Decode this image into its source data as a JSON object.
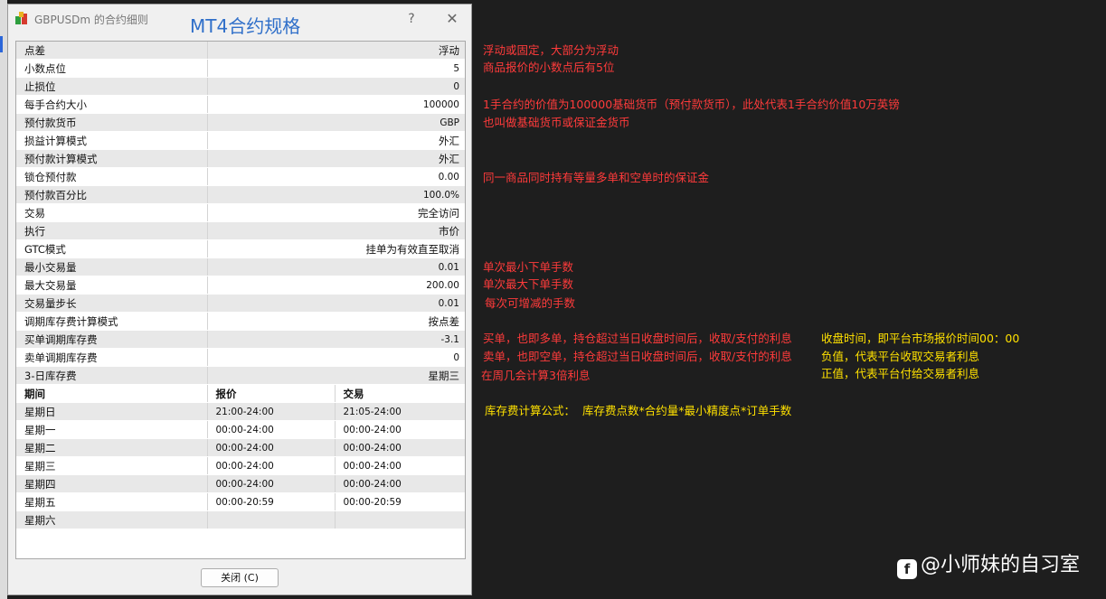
{
  "window": {
    "title": "GBPUSDm 的合约细则",
    "overlay_title": "MT4合约规格",
    "help_glyph": "?",
    "close_glyph": "✕",
    "close_button": "关闭 (C)"
  },
  "specs": [
    {
      "label": "点差",
      "value": "浮动"
    },
    {
      "label": "小数点位",
      "value": "5"
    },
    {
      "label": "止损位",
      "value": "0"
    },
    {
      "label": "每手合约大小",
      "value": "100000"
    },
    {
      "label": "预付款货币",
      "value": "GBP"
    },
    {
      "label": "损益计算模式",
      "value": "外汇"
    },
    {
      "label": "预付款计算模式",
      "value": "外汇"
    },
    {
      "label": "锁仓预付款",
      "value": "0.00"
    },
    {
      "label": "预付款百分比",
      "value": "100.0%"
    },
    {
      "label": "交易",
      "value": "完全访问"
    },
    {
      "label": "执行",
      "value": "市价"
    },
    {
      "label": "GTC模式",
      "value": "挂单为有效直至取消"
    },
    {
      "label": "最小交易量",
      "value": "0.01"
    },
    {
      "label": "最大交易量",
      "value": "200.00"
    },
    {
      "label": "交易量步长",
      "value": "0.01"
    },
    {
      "label": "调期库存费计算模式",
      "value": "按点差"
    },
    {
      "label": "买单调期库存费",
      "value": "-3.1"
    },
    {
      "label": "卖单调期库存费",
      "value": "0"
    },
    {
      "label": "3-日库存费",
      "value": "星期三"
    }
  ],
  "schedule": {
    "headers": [
      "期间",
      "报价",
      "交易"
    ],
    "rows": [
      {
        "day": "星期日",
        "quote": "21:00-24:00",
        "trade": "21:05-24:00"
      },
      {
        "day": "星期一",
        "quote": "00:00-24:00",
        "trade": "00:00-24:00"
      },
      {
        "day": "星期二",
        "quote": "00:00-24:00",
        "trade": "00:00-24:00"
      },
      {
        "day": "星期三",
        "quote": "00:00-24:00",
        "trade": "00:00-24:00"
      },
      {
        "day": "星期四",
        "quote": "00:00-24:00",
        "trade": "00:00-24:00"
      },
      {
        "day": "星期五",
        "quote": "00:00-20:59",
        "trade": "00:00-20:59"
      },
      {
        "day": "星期六",
        "quote": "",
        "trade": ""
      }
    ]
  },
  "annotations": {
    "spread": "浮动或固定，大部分为浮动",
    "digits": "商品报价的小数点后有5位",
    "contract_size": "1手合约的价值为100000基础货币（预付款货币），此处代表1手合约价值10万英镑",
    "margin_currency": "也叫做基础货币或保证金货币",
    "hedged_margin": "同一商品同时持有等量多单和空单时的保证金",
    "min_volume": "单次最小下单手数",
    "max_volume": "单次最大下单手数",
    "volume_step": "每次可增减的手数",
    "swap_long": "买单，也即多单，持仓超过当日收盘时间后，收取/支付的利息",
    "swap_short": "卖单，也即空单，持仓超过当日收盘时间后，收取/支付的利息",
    "triple_swap": "在周几会计算3倍利息",
    "close_time": "收盘时间，即平台市场报价时间00：00",
    "negative_note": "负值，代表平台收取交易者利息",
    "positive_note": "正值，代表平台付给交易者利息",
    "formula": "库存费计算公式：  库存费点数*合约量*最小精度点*订单手数"
  },
  "watermark": {
    "icon": "f",
    "text": "@小师妹的自习室"
  },
  "colors": {
    "annotation_red": "#ff3b3b",
    "annotation_yellow": "#ffe100",
    "overlay_title_blue": "#2f6fc9"
  }
}
